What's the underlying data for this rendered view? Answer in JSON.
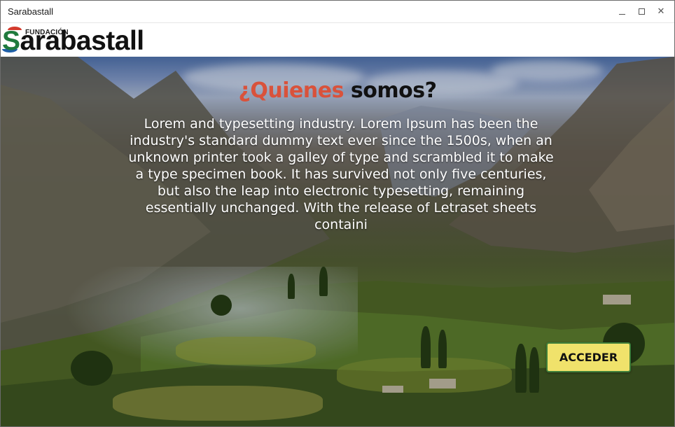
{
  "window": {
    "title": "Sarabastall"
  },
  "logo": {
    "small_text": "FUNDACIÓN",
    "brand_initial": "S",
    "brand_rest": "arabastall"
  },
  "hero": {
    "title_accent": "¿Quienes",
    "title_rest": "somos?",
    "body": "Lorem and typesetting industry. Lorem Ipsum has been the industry's standard dummy text ever since the 1500s, when an unknown printer took a galley of type and scrambled it to make a type specimen book. It has survived not only five centuries, but also the leap into electronic typesetting, remaining essentially unchanged. With the release of Letraset sheets containi",
    "button_label": "ACCEDER"
  },
  "colors": {
    "title_accent": "#d9523b",
    "button_bg": "#f0e26b",
    "button_border": "#3f7f3a",
    "logo_green": "#1f7a3d",
    "logo_red": "#d33a2c",
    "logo_blue": "#1f5fa8"
  },
  "icons": {
    "minimize": "minimize-icon",
    "maximize": "maximize-icon",
    "close": "close-icon"
  }
}
